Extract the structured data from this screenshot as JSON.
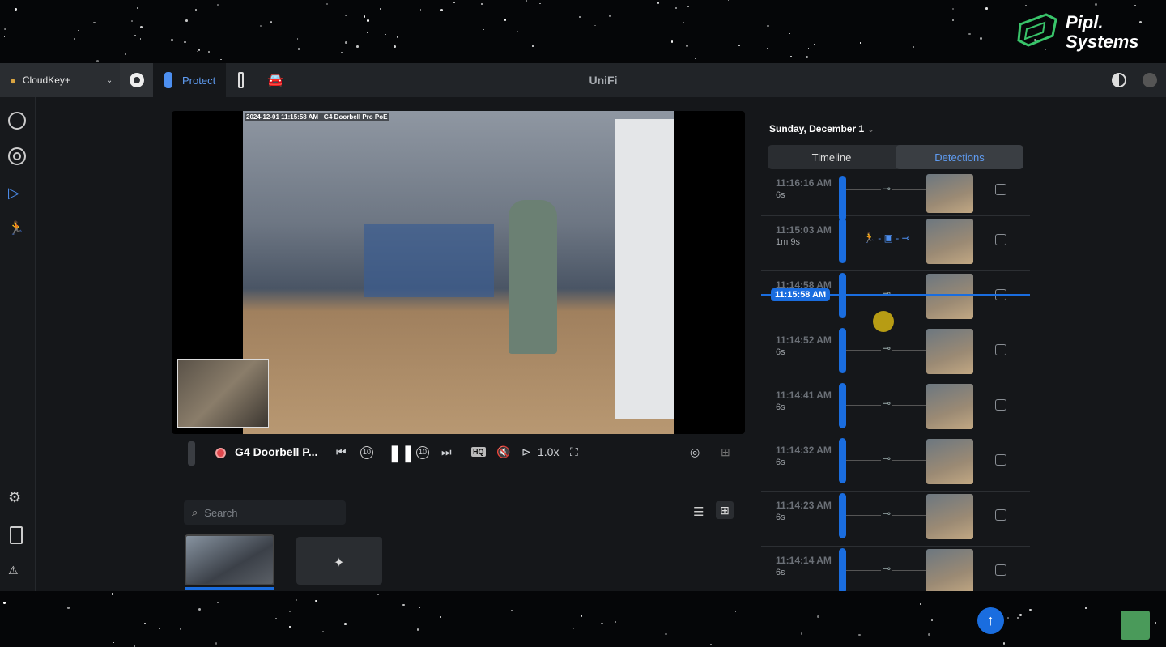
{
  "brand": {
    "name_line1": "Pipl.",
    "name_line2": "Systems"
  },
  "topbar": {
    "console": "CloudKey+",
    "app": "Protect",
    "title": "UniFi"
  },
  "sidebar": {
    "items": [
      "dashboard-icon",
      "devices-icon",
      "play-icon",
      "detections-icon"
    ],
    "bottom": [
      "settings-icon",
      "logs-icon",
      "alarm-icon"
    ]
  },
  "video": {
    "timestamp": "2024-12-01 11:15:58 AM | G4 Doorbell Pro PoE"
  },
  "controls": {
    "camera": "G4 Doorbell P...",
    "skip_back": "10",
    "skip_fwd": "10",
    "quality": "HQ",
    "speed": "1.0x"
  },
  "search": {
    "placeholder": "Search"
  },
  "panel": {
    "date": "Sunday, December 1",
    "tabs": [
      "Timeline",
      "Detections"
    ],
    "active_tab": "Detections",
    "current_time": "11:15:58 AM"
  },
  "detections": [
    {
      "time": "11:16:16 AM",
      "duration": "6s",
      "icons": "⊸"
    },
    {
      "time": "11:15:03 AM",
      "duration": "1m 9s",
      "icons": "person - vehicle - motion"
    },
    {
      "time": "11:14:58 AM",
      "duration": "6s",
      "icons": "⊸"
    },
    {
      "time": "11:14:52 AM",
      "duration": "6s",
      "icons": "⊸"
    },
    {
      "time": "11:14:41 AM",
      "duration": "6s",
      "icons": "⊸"
    },
    {
      "time": "11:14:32 AM",
      "duration": "6s",
      "icons": "⊸"
    },
    {
      "time": "11:14:23 AM",
      "duration": "6s",
      "icons": "⊸"
    },
    {
      "time": "11:14:14 AM",
      "duration": "6s",
      "icons": "⊸"
    }
  ],
  "colors": {
    "accent": "#1a6ddf",
    "bg": "#15171a",
    "topbar": "#212428"
  }
}
